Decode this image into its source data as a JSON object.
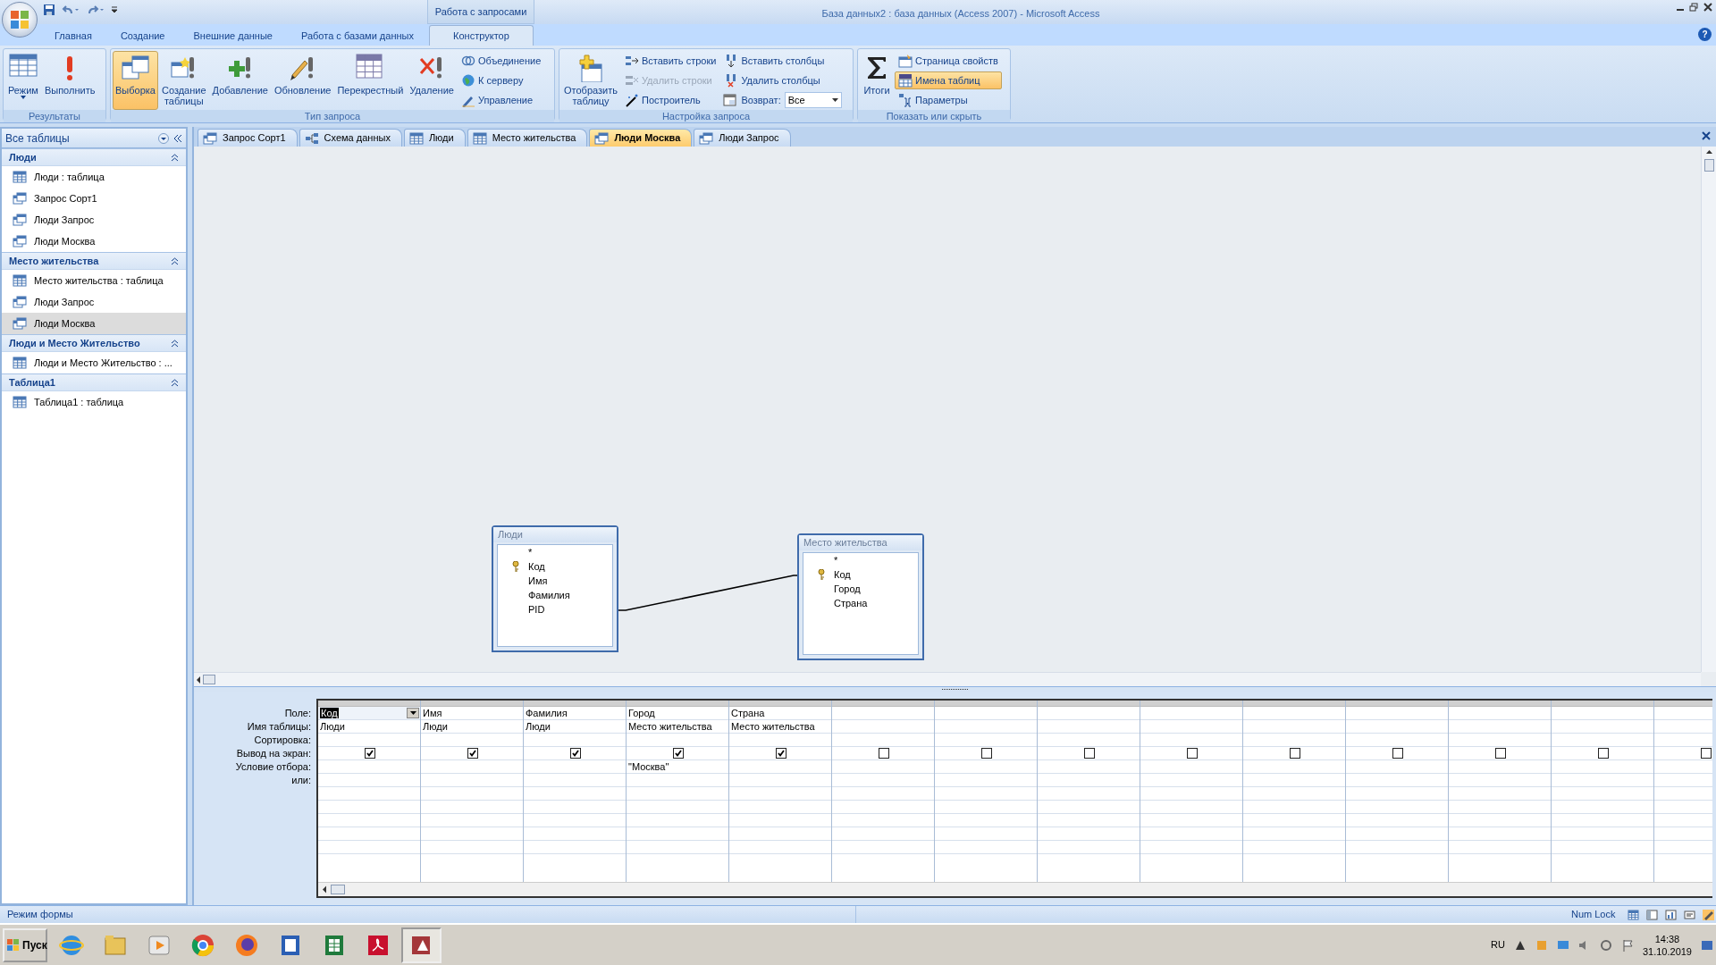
{
  "window": {
    "title": "База данных2 : база данных (Access 2007) - Microsoft Access",
    "context_tab": "Работа с запросами",
    "help_glyph": "?"
  },
  "ribbon_tabs": [
    {
      "label": "Главная",
      "selected": false
    },
    {
      "label": "Создание",
      "selected": false
    },
    {
      "label": "Внешние данные",
      "selected": false
    },
    {
      "label": "Работа с базами данных",
      "selected": false
    },
    {
      "label": "Конструктор",
      "selected": true
    }
  ],
  "ribbon_groups": [
    {
      "title": "Результаты",
      "items": [
        {
          "kind": "split",
          "label": "Режим",
          "selected": false,
          "disabled": false
        },
        {
          "kind": "large",
          "label": "Выполнить",
          "selected": false,
          "disabled": false
        }
      ]
    },
    {
      "title": "Тип запроса",
      "items": [
        {
          "kind": "large",
          "label": "Выборка",
          "selected": true,
          "disabled": false
        },
        {
          "kind": "large",
          "label": "Создание\nтаблицы",
          "selected": false,
          "disabled": false
        },
        {
          "kind": "large",
          "label": "Добавление",
          "selected": false,
          "disabled": false
        },
        {
          "kind": "large",
          "label": "Обновление",
          "selected": false,
          "disabled": false
        },
        {
          "kind": "large",
          "label": "Перекрестный",
          "selected": false,
          "disabled": false
        },
        {
          "kind": "large",
          "label": "Удаление",
          "selected": false,
          "disabled": false
        },
        {
          "kind": "small",
          "label": "Объединение",
          "selected": false,
          "disabled": false
        },
        {
          "kind": "small",
          "label": "К серверу",
          "selected": false,
          "disabled": false
        },
        {
          "kind": "small",
          "label": "Управление",
          "selected": false,
          "disabled": false
        }
      ]
    },
    {
      "title": "Настройка запроса",
      "items": [
        {
          "kind": "large",
          "label": "Отобразить\nтаблицу",
          "selected": false,
          "disabled": false
        },
        {
          "kind": "small",
          "label": "Вставить строки",
          "selected": false,
          "disabled": false
        },
        {
          "kind": "small",
          "label": "Удалить строки",
          "selected": false,
          "disabled": true
        },
        {
          "kind": "small",
          "label": "Построитель",
          "selected": false,
          "disabled": false
        },
        {
          "kind": "small",
          "label": "Вставить столбцы",
          "selected": false,
          "disabled": false
        },
        {
          "kind": "small",
          "label": "Удалить столбцы",
          "selected": false,
          "disabled": false
        },
        {
          "kind": "combo",
          "label": "Возврат:",
          "value": "Все",
          "selected": false,
          "disabled": false
        }
      ]
    },
    {
      "title": "Показать или скрыть",
      "items": [
        {
          "kind": "large",
          "label": "Итоги",
          "selected": false,
          "disabled": false
        },
        {
          "kind": "small",
          "label": "Страница свойств",
          "selected": false,
          "disabled": false
        },
        {
          "kind": "small",
          "label": "Имена таблиц",
          "selected": true,
          "disabled": false
        },
        {
          "kind": "small",
          "label": "Параметры",
          "selected": false,
          "disabled": false
        }
      ]
    }
  ],
  "sidebar": {
    "title": "Все таблицы",
    "groups": [
      {
        "title": "Люди",
        "expanded": true,
        "items": [
          {
            "kind": "table",
            "label": "Люди : таблица",
            "selected": false
          },
          {
            "kind": "query",
            "label": "Запрос Сорт1",
            "selected": false
          },
          {
            "kind": "query",
            "label": "Люди Запрос",
            "selected": false
          },
          {
            "kind": "query",
            "label": "Люди Москва",
            "selected": false
          }
        ]
      },
      {
        "title": "Место жительства",
        "expanded": true,
        "items": [
          {
            "kind": "table",
            "label": "Место жительства : таблица",
            "selected": false
          },
          {
            "kind": "query",
            "label": "Люди Запрос",
            "selected": false
          },
          {
            "kind": "query",
            "label": "Люди Москва",
            "selected": true
          }
        ]
      },
      {
        "title": "Люди и Место Жительство",
        "expanded": true,
        "items": [
          {
            "kind": "table",
            "label": "Люди и Место Жительство : ...",
            "selected": false
          }
        ]
      },
      {
        "title": "Таблица1",
        "expanded": true,
        "items": [
          {
            "kind": "table",
            "label": "Таблица1 : таблица",
            "selected": false
          }
        ]
      }
    ]
  },
  "doc_tabs": [
    {
      "kind": "query",
      "label": "Запрос Сорт1",
      "selected": false
    },
    {
      "kind": "diagram",
      "label": "Схема данных",
      "selected": false
    },
    {
      "kind": "table",
      "label": "Люди",
      "selected": false
    },
    {
      "kind": "table",
      "label": "Место жительства",
      "selected": false
    },
    {
      "kind": "query",
      "label": "Люди Москва",
      "selected": true
    },
    {
      "kind": "query",
      "label": "Люди Запрос",
      "selected": false
    }
  ],
  "diagram_tables": [
    {
      "title": "Люди",
      "fields": [
        {
          "name": "*",
          "key": false
        },
        {
          "name": "Код",
          "key": true
        },
        {
          "name": "Имя",
          "key": false
        },
        {
          "name": "Фамилия",
          "key": false
        },
        {
          "name": "PID",
          "key": false
        }
      ]
    },
    {
      "title": "Место жительства",
      "fields": [
        {
          "name": "*",
          "key": false
        },
        {
          "name": "Код",
          "key": true
        },
        {
          "name": "Город",
          "key": false
        },
        {
          "name": "Страна",
          "key": false
        }
      ]
    }
  ],
  "grid": {
    "row_labels": [
      "Поле:",
      "Имя таблицы:",
      "Сортировка:",
      "Вывод на экран:",
      "Условие отбора:",
      "или:"
    ],
    "columns": [
      {
        "field": "Код",
        "table": "Люди",
        "show": true,
        "selected": true
      },
      {
        "field": "Имя",
        "table": "Люди",
        "show": true,
        "selected": false
      },
      {
        "field": "Фамилия",
        "table": "Люди",
        "show": true,
        "selected": false
      },
      {
        "field": "Город",
        "table": "Место жительства",
        "show": true,
        "selected": false,
        "criteria": "\"Москва\""
      },
      {
        "field": "Страна",
        "table": "Место жительства",
        "show": true,
        "selected": false
      },
      {
        "show": false,
        "selected": false
      },
      {
        "show": false,
        "selected": false
      },
      {
        "show": false,
        "selected": false
      },
      {
        "show": false,
        "selected": false
      },
      {
        "show": false,
        "selected": false
      },
      {
        "show": false,
        "selected": false
      },
      {
        "show": false,
        "selected": false
      },
      {
        "show": false,
        "selected": false
      },
      {
        "show": false,
        "selected": false
      }
    ]
  },
  "status_bar": {
    "left": "Режим формы",
    "right": "Num Lock"
  },
  "taskbar": {
    "start": "Пуск",
    "apps": [
      {
        "active": false
      },
      {
        "active": false
      },
      {
        "active": false
      },
      {
        "active": false
      },
      {
        "active": false
      },
      {
        "active": false
      },
      {
        "active": false
      },
      {
        "active": false
      },
      {
        "active": true
      }
    ],
    "language": "RU",
    "time": "14:38",
    "date": "31.10.2019"
  }
}
